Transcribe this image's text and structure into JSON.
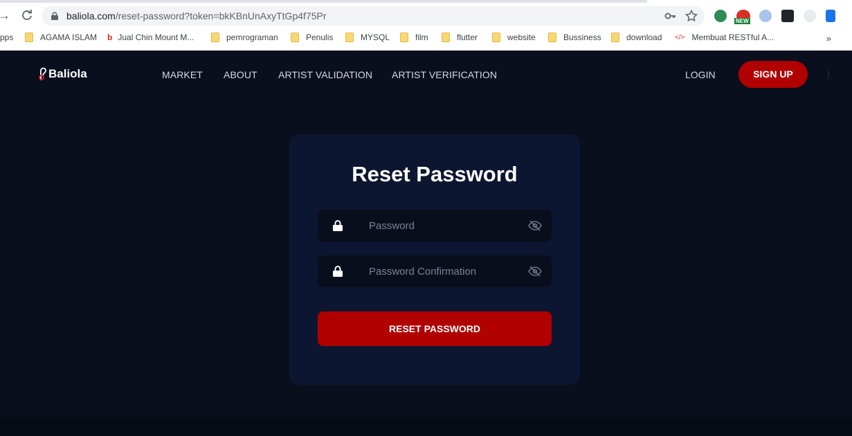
{
  "browser": {
    "url_host": "baliola.com",
    "url_path": "/reset-password?token=bkKBnUnAxyTtGp4f75Pr",
    "bookmarks": [
      {
        "label": "pps",
        "type": "text"
      },
      {
        "label": "AGAMA ISLAM",
        "type": "folder"
      },
      {
        "label": "Jual Chin Mount M...",
        "type": "site"
      },
      {
        "label": "pemrograman",
        "type": "folder"
      },
      {
        "label": "Penulis",
        "type": "folder"
      },
      {
        "label": "MYSQL",
        "type": "folder"
      },
      {
        "label": "film",
        "type": "folder"
      },
      {
        "label": "flutter",
        "type": "folder"
      },
      {
        "label": "website",
        "type": "folder"
      },
      {
        "label": "Bussiness",
        "type": "folder"
      },
      {
        "label": "download",
        "type": "folder"
      },
      {
        "label": "Membuat RESTful A...",
        "type": "code"
      }
    ],
    "bookmarks_more": "»",
    "ext_badge": "NEW",
    "icons": [
      "back-arrow-icon",
      "reload-icon",
      "lock-icon",
      "key-icon",
      "star-icon"
    ]
  },
  "header": {
    "logo_text": "Baliola",
    "nav": [
      "MARKET",
      "ABOUT",
      "ARTIST VALIDATION",
      "ARTIST VERIFICATION"
    ],
    "login": "LOGIN",
    "signup": "SIGN UP"
  },
  "card": {
    "title": "Reset Password",
    "password_placeholder": "Password",
    "confirm_placeholder": "Password Confirmation",
    "button": "RESET PASSWORD"
  },
  "colors": {
    "background": "#0a0f1d",
    "card": "#0d1630",
    "field": "#080e1c",
    "accent": "#b00000"
  }
}
